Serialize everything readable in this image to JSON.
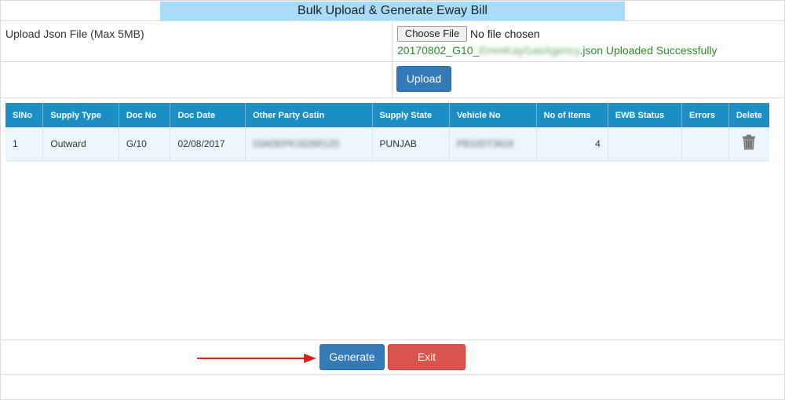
{
  "page": {
    "title": "Bulk Upload & Generate Eway Bill"
  },
  "upload": {
    "label": "Upload Json File (Max 5MB)",
    "choose_file_label": "Choose File",
    "no_file_text": "No file chosen",
    "success_prefix": "20170802_G10_",
    "success_blurred": "EmmKayGasAgency",
    "success_suffix": ".json Uploaded Successfully",
    "upload_button": "Upload"
  },
  "table": {
    "columns": [
      "SlNo",
      "Supply Type",
      "Doc No",
      "Doc Date",
      "Other Party Gstin",
      "Supply State",
      "Vehicle No",
      "No of Items",
      "EWB Status",
      "Errors",
      "Delete"
    ],
    "rows": [
      {
        "slno": "1",
        "supply_type": "Outward",
        "doc_no": "G/10",
        "doc_date": "02/08/2017",
        "gstin": "03ADEPK1626R1Z0",
        "supply_state": "PUNJAB",
        "vehicle_no": "PB10DT3618",
        "items": "4",
        "ewb_status": "",
        "errors": ""
      }
    ]
  },
  "actions": {
    "generate": "Generate",
    "exit": "Exit"
  },
  "colors": {
    "title_bg": "#a8dcf8",
    "header_bg": "#1b8ec4",
    "primary": "#337ab7",
    "danger": "#d9534f",
    "success_text": "#2e8b2e",
    "arrow": "#e02020"
  },
  "icons": {
    "delete": "trash-icon",
    "annotation": "red-arrow-icon"
  }
}
